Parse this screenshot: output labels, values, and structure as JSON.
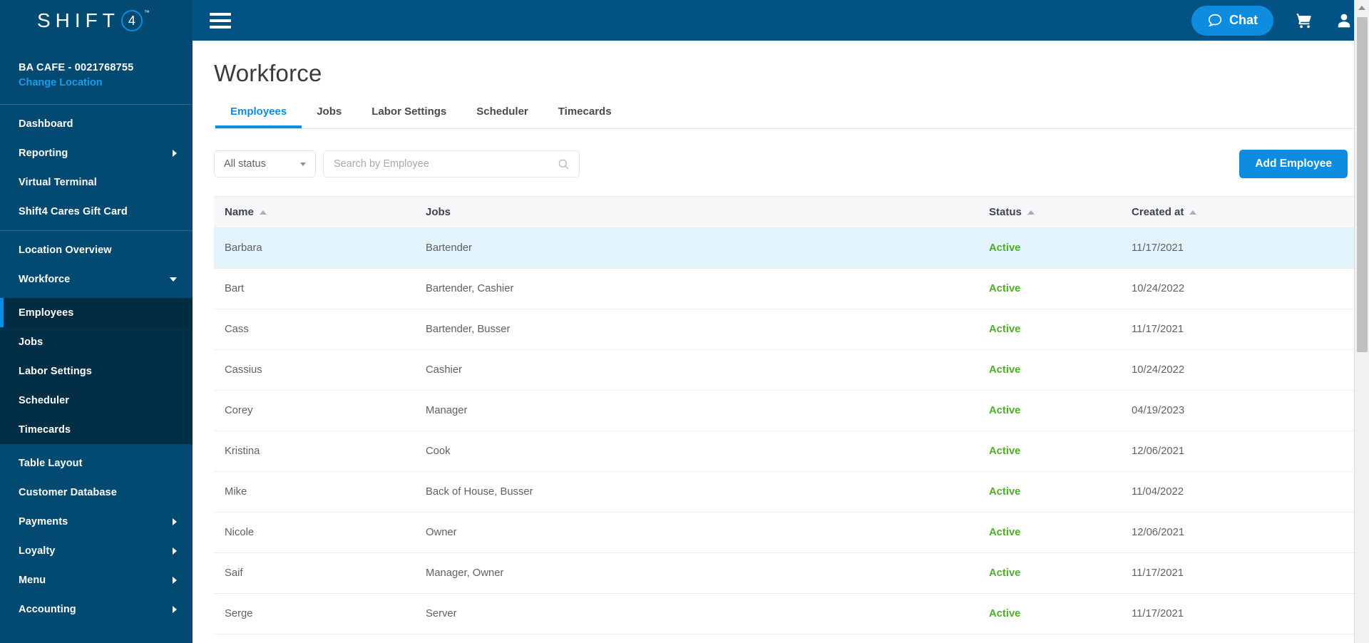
{
  "brand": {
    "logo_text": "SHIFT",
    "logo_badge": "4",
    "trademark": "™",
    "accent_color": "#0d8ce0",
    "sidebar_color": "#034A72",
    "topbar_color": "#025383",
    "status_active_color": "#4caf27"
  },
  "sidebar": {
    "location_name": "BA CAFE - 0021768755",
    "change_location_label": "Change Location",
    "group1": [
      {
        "label": "Dashboard",
        "expandable": false
      },
      {
        "label": "Reporting",
        "expandable": true
      },
      {
        "label": "Virtual Terminal",
        "expandable": false
      },
      {
        "label": "Shift4 Cares Gift Card",
        "expandable": false
      }
    ],
    "group2": [
      {
        "label": "Location Overview",
        "expandable": false
      },
      {
        "label": "Workforce",
        "expandable": true,
        "expanded": true
      }
    ],
    "submenu": [
      {
        "label": "Employees",
        "active": true
      },
      {
        "label": "Jobs",
        "active": false
      },
      {
        "label": "Labor Settings",
        "active": false
      },
      {
        "label": "Scheduler",
        "active": false
      },
      {
        "label": "Timecards",
        "active": false
      }
    ],
    "group3": [
      {
        "label": "Table Layout",
        "expandable": false
      },
      {
        "label": "Customer Database",
        "expandable": false
      },
      {
        "label": "Payments",
        "expandable": true
      },
      {
        "label": "Loyalty",
        "expandable": true
      },
      {
        "label": "Menu",
        "expandable": true
      },
      {
        "label": "Accounting",
        "expandable": true
      }
    ]
  },
  "topbar": {
    "menu_icon": "hamburger-icon",
    "chat_label": "Chat",
    "chat_icon": "chat-bubble-icon",
    "cart_icon": "shopping-cart-icon",
    "account_icon": "user-account-icon"
  },
  "page": {
    "title": "Workforce",
    "tabs": [
      {
        "label": "Employees",
        "active": true
      },
      {
        "label": "Jobs",
        "active": false
      },
      {
        "label": "Labor Settings",
        "active": false
      },
      {
        "label": "Scheduler",
        "active": false
      },
      {
        "label": "Timecards",
        "active": false
      }
    ]
  },
  "filters": {
    "status_select_value": "All status",
    "search_placeholder": "Search by Employee",
    "search_value": "",
    "add_employee_label": "Add Employee"
  },
  "table": {
    "columns": [
      {
        "label": "Name",
        "sortable": true
      },
      {
        "label": "Jobs",
        "sortable": false
      },
      {
        "label": "Status",
        "sortable": true
      },
      {
        "label": "Created at",
        "sortable": true
      }
    ],
    "rows": [
      {
        "name": "Barbara",
        "jobs": "Bartender",
        "status": "Active",
        "created": "11/17/2021",
        "selected": true
      },
      {
        "name": "Bart",
        "jobs": "Bartender, Cashier",
        "status": "Active",
        "created": "10/24/2022",
        "selected": false
      },
      {
        "name": "Cass",
        "jobs": "Bartender, Busser",
        "status": "Active",
        "created": "11/17/2021",
        "selected": false
      },
      {
        "name": "Cassius",
        "jobs": "Cashier",
        "status": "Active",
        "created": "10/24/2022",
        "selected": false
      },
      {
        "name": "Corey",
        "jobs": "Manager",
        "status": "Active",
        "created": "04/19/2023",
        "selected": false
      },
      {
        "name": "Kristina",
        "jobs": "Cook",
        "status": "Active",
        "created": "12/06/2021",
        "selected": false
      },
      {
        "name": "Mike",
        "jobs": "Back of House, Busser",
        "status": "Active",
        "created": "11/04/2022",
        "selected": false
      },
      {
        "name": "Nicole",
        "jobs": "Owner",
        "status": "Active",
        "created": "12/06/2021",
        "selected": false
      },
      {
        "name": "Saif",
        "jobs": "Manager, Owner",
        "status": "Active",
        "created": "11/17/2021",
        "selected": false
      },
      {
        "name": "Serge",
        "jobs": "Server",
        "status": "Active",
        "created": "11/17/2021",
        "selected": false
      }
    ]
  },
  "scrollbar": {
    "up_arrow_icon": "scroll-up-arrow-icon"
  }
}
